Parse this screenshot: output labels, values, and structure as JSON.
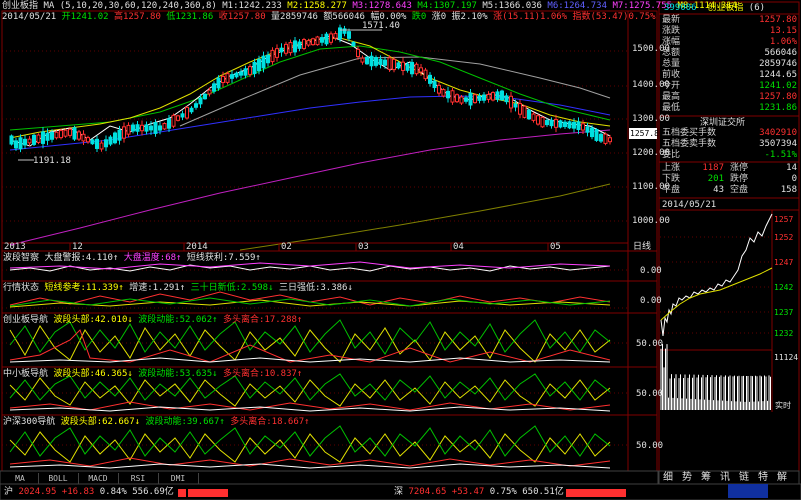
{
  "title": {
    "name": "创业板指",
    "ma_label": "MA (5,10,20,30,60,120,240,360,8)",
    "m1": "M1:1242.233",
    "m2": "M2:1258.277",
    "m3": "M3:1278.643",
    "m4": "M4:1307.197",
    "m5": "M5:1366.036",
    "m6": "M6:1264.734",
    "m7": "M7:1275.755",
    "m8": "M8:1114.314"
  },
  "ohlc": {
    "date": "2014/05/21",
    "open": "开1241.02",
    "high": "高1257.80",
    "low": "低1231.86",
    "close": "收1257.80",
    "volume": "量2859746",
    "amount": "额566046",
    "change_pct": "幅0.00%",
    "down_count": "跌0",
    "up_count": "涨0",
    "amp": "振2.10%",
    "swing": "涨(15.11)1.06%",
    "index": "指数(53.47)0.75%"
  },
  "price_axis": [
    "1500.00",
    "1400.00",
    "1300.00",
    "1200.00",
    "1100.00",
    "1000.00"
  ],
  "price_labels": {
    "peak": "1571.40",
    "trough": "1191.18",
    "last": "1257.8"
  },
  "time_axis": [
    "2013",
    "12",
    "2014",
    "02",
    "03",
    "04",
    "05",
    "日线"
  ],
  "ind1": {
    "name": "波段智察",
    "a": "大盘警报:4.110↑",
    "b": "大盘温度:68↑",
    "c": "短线获利:7.559↑",
    "axis": [
      "0.00"
    ]
  },
  "ind2": {
    "name": "行情状态",
    "a": "短线参考:11.339↑",
    "b": "增速:1.291↑",
    "c": "三十日新低:2.598↓",
    "d": "三日强低:3.386↓",
    "axis": [
      "0.00"
    ]
  },
  "ind3": {
    "name": "创业板导航",
    "a": "波段头部:42.010↓",
    "b": "波段动能:52.062↑",
    "c": "多头离合:17.288↑",
    "axis": [
      "50.00"
    ]
  },
  "ind4": {
    "name": "中小板导航",
    "a": "波段头部:46.365↓",
    "b": "波段动能:53.635↓",
    "c": "多头离合:10.837↑",
    "axis": [
      "50.00"
    ]
  },
  "ind5": {
    "name": "沪深300导航",
    "a": "波段头部:62.667↓",
    "b": "波段动能:39.667↑",
    "c": "多头离合:18.667↑",
    "axis": [
      "50.00"
    ]
  },
  "tabs": [
    "MA",
    "BOLL",
    "MACD",
    "RSI",
    "DMI"
  ],
  "sidebar": {
    "code": "399006",
    "name": "创业板指",
    "badge": "(6)",
    "rows": [
      {
        "label": "最新",
        "value": "1257.80",
        "color": "#ff3030"
      },
      {
        "label": "涨跌",
        "value": "13.15",
        "color": "#ff3030"
      },
      {
        "label": "涨幅",
        "value": "1.06%",
        "color": "#ff3030"
      },
      {
        "label": "总额",
        "value": "566046",
        "color": "#e0e0e0"
      },
      {
        "label": "总量",
        "value": "2859746",
        "color": "#e0e0e0"
      },
      {
        "label": "前收",
        "value": "1244.65",
        "color": "#e0e0e0"
      },
      {
        "label": "今开",
        "value": "1241.02",
        "color": "#00e000"
      },
      {
        "label": "最高",
        "value": "1257.80",
        "color": "#ff3030"
      },
      {
        "label": "最低",
        "value": "1231.86",
        "color": "#00e000"
      }
    ],
    "exchange": "深圳证交所",
    "rows2": [
      {
        "label": "五档委买手数",
        "value": "3402910",
        "color": "#ff3030"
      },
      {
        "label": "五档委卖手数",
        "value": "3507394",
        "color": "#e0e0e0"
      },
      {
        "label": "委比",
        "value": "-1.51%",
        "color": "#00e000"
      }
    ],
    "stats": [
      {
        "l1": "上涨",
        "v1": "1187",
        "l2": "涨停",
        "v2": "14",
        "c1": "#ff3030"
      },
      {
        "l1": "下跌",
        "v1": "201",
        "l2": "跌停",
        "v2": "0",
        "c1": "#00e000"
      },
      {
        "l1": "平盘",
        "v1": "43",
        "l2": "空盘",
        "v2": "158",
        "c1": "#e0e0e0"
      }
    ],
    "mini_date": "2014/05/21",
    "mini_axis": [
      "1257",
      "1252",
      "1247",
      "1242",
      "1237",
      "1232",
      "11124"
    ],
    "mini_label": "实时",
    "bottom_tabs": [
      "细",
      "势",
      "筹",
      "讯",
      "链",
      "特",
      "解"
    ]
  },
  "status": {
    "sh_label": "沪",
    "sh_value": "2024.95",
    "sh_change": "+16.83",
    "sh_pct": "0.84%",
    "sh_amt": "556.69亿",
    "sz_label": "深",
    "sz_value": "7204.65",
    "sz_change": "+53.47",
    "sz_pct": "0.75%",
    "sz_amt": "650.51亿"
  }
}
